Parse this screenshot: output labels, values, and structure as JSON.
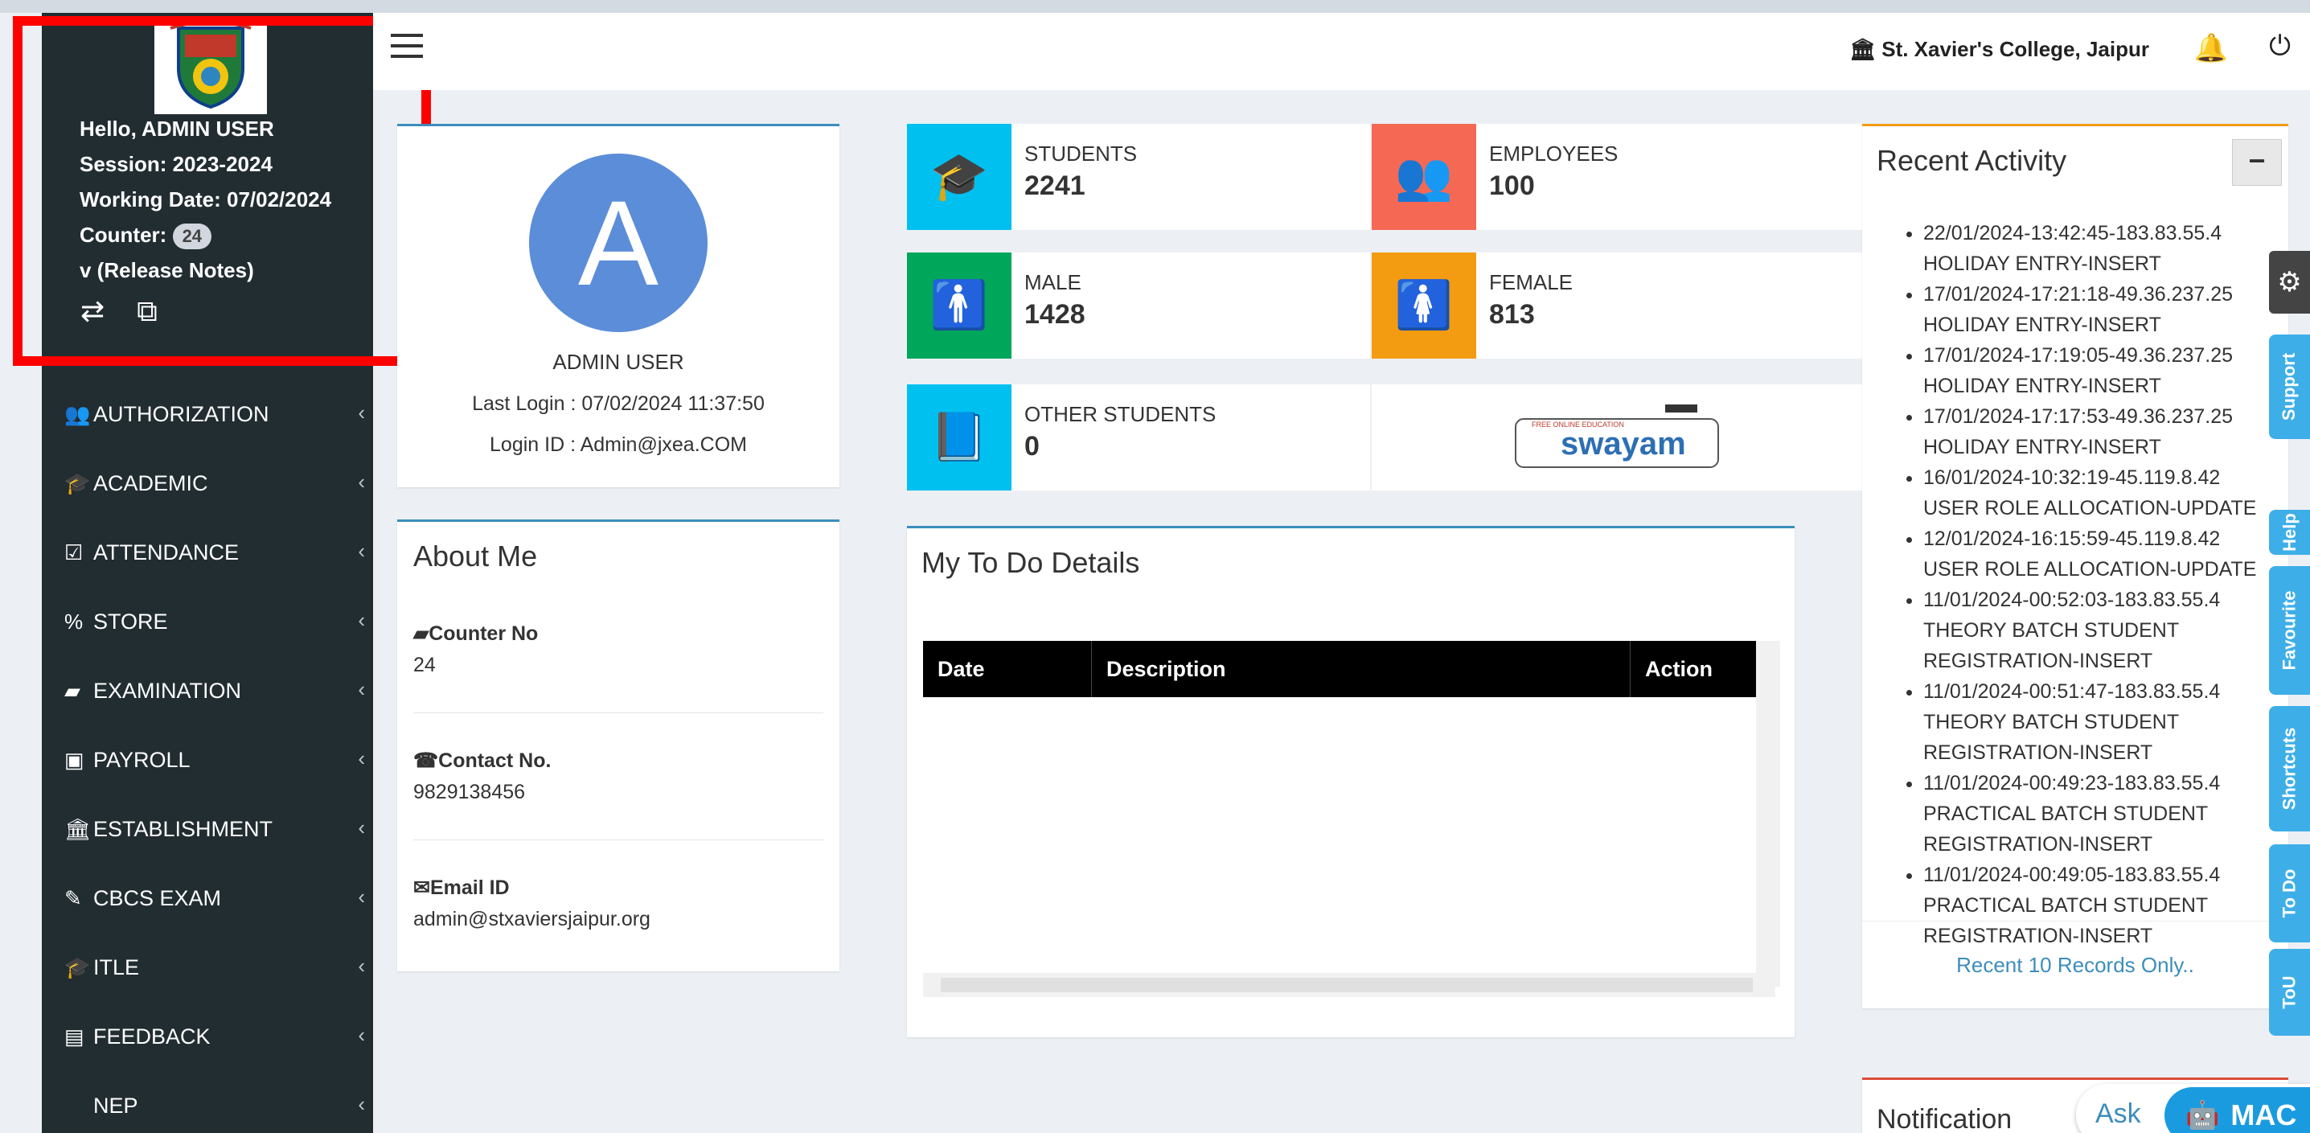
{
  "colors": {
    "sidebar_bg": "#222d32",
    "accent_blue": "#3c8dbc",
    "students_icon_bg": "#00c0ef",
    "employees_icon_bg": "#f56954",
    "male_icon_bg": "#00a65a",
    "female_icon_bg": "#f39c12",
    "other_icon_bg": "#00c0ef",
    "highlight_box": "#ff0000",
    "avatar_bg": "#5b8dd9",
    "side_tab_bg": "#3eaee8"
  },
  "sidebar": {
    "greeting": "Hello, ADMIN USER",
    "session": "Session: 2023-2024",
    "working_date": "Working Date: 07/02/2024",
    "counter_label": "Counter:",
    "counter_value": "24",
    "release_notes": "v (Release Notes)",
    "quick_icons": [
      "refresh-icon",
      "copy-icon"
    ],
    "menu": [
      {
        "label": "AUTHORIZATION",
        "icon": "user-plus-icon",
        "glyph": "👥"
      },
      {
        "label": "ACADEMIC",
        "icon": "graduation-cap-icon",
        "glyph": "🎓"
      },
      {
        "label": "ATTENDANCE",
        "icon": "check-square-icon",
        "glyph": "☑"
      },
      {
        "label": "STORE",
        "icon": "percent-icon",
        "glyph": "%"
      },
      {
        "label": "EXAMINATION",
        "icon": "book-icon",
        "glyph": "▰"
      },
      {
        "label": "PAYROLL",
        "icon": "money-icon",
        "glyph": "▣"
      },
      {
        "label": "ESTABLISHMENT",
        "icon": "bank-icon",
        "glyph": "🏛"
      },
      {
        "label": "CBCS EXAM",
        "icon": "edit-icon",
        "glyph": "✎"
      },
      {
        "label": "ITLE",
        "icon": "graduation-cap-icon",
        "glyph": "🎓"
      },
      {
        "label": "FEEDBACK",
        "icon": "list-alt-icon",
        "glyph": "▤"
      },
      {
        "label": "NEP",
        "icon": "",
        "glyph": ""
      }
    ]
  },
  "header": {
    "college_name": "St. Xavier's College, Jaipur",
    "bank_glyph": "🏛",
    "bell_glyph": "🔔",
    "power_glyph": "⏻"
  },
  "profile": {
    "avatar_letter": "A",
    "name": "ADMIN USER",
    "last_login": "Last Login : 07/02/2024 11:37:50",
    "login_id": "Login ID : Admin@jxea.COM"
  },
  "about": {
    "title": "About Me",
    "counter_label": "Counter No",
    "counter_value": "24",
    "contact_label": "Contact No.",
    "contact_value": "9829138456",
    "email_label": "Email ID",
    "email_value": "admin@stxaviersjaipur.org"
  },
  "stats": {
    "students": {
      "label": "STUDENTS",
      "value": "2241",
      "glyph": "🎓"
    },
    "employees": {
      "label": "EMPLOYEES",
      "value": "100",
      "glyph": "👥"
    },
    "male": {
      "label": "MALE",
      "value": "1428",
      "glyph": "🚹"
    },
    "female": {
      "label": "FEMALE",
      "value": "813",
      "glyph": "🚺"
    },
    "other": {
      "label": "OTHER STUDENTS",
      "value": "0",
      "glyph": "📘"
    }
  },
  "swayam": {
    "tag": "FREE ONLINE EDUCATION",
    "brand": "swayam"
  },
  "todo": {
    "title": "My To Do Details",
    "columns": [
      "Date",
      "Description",
      "Action"
    ]
  },
  "recent": {
    "title": "Recent Activity",
    "collapse_label": "−",
    "items": [
      "22/01/2024-13:42:45-183.83.55.4 HOLIDAY ENTRY-INSERT",
      "17/01/2024-17:21:18-49.36.237.25 HOLIDAY ENTRY-INSERT",
      "17/01/2024-17:19:05-49.36.237.25 HOLIDAY ENTRY-INSERT",
      "17/01/2024-17:17:53-49.36.237.25 HOLIDAY ENTRY-INSERT",
      "16/01/2024-10:32:19-45.119.8.42 USER ROLE ALLOCATION-UPDATE",
      "12/01/2024-16:15:59-45.119.8.42 USER ROLE ALLOCATION-UPDATE",
      "11/01/2024-00:52:03-183.83.55.4 THEORY BATCH STUDENT REGISTRATION-INSERT",
      "11/01/2024-00:51:47-183.83.55.4 THEORY BATCH STUDENT REGISTRATION-INSERT",
      "11/01/2024-00:49:23-183.83.55.4 PRACTICAL BATCH STUDENT REGISTRATION-INSERT",
      "11/01/2024-00:49:05-183.83.55.4 PRACTICAL BATCH STUDENT REGISTRATION-INSERT"
    ],
    "footer": "Recent 10 Records Only.."
  },
  "notification": {
    "title": "Notification"
  },
  "side_tabs": [
    "Support",
    "Help",
    "Favourite",
    "Shortcuts",
    "To Do",
    "ToU"
  ],
  "ask_bot": {
    "ask_label": "Ask",
    "brand": "MAC"
  }
}
